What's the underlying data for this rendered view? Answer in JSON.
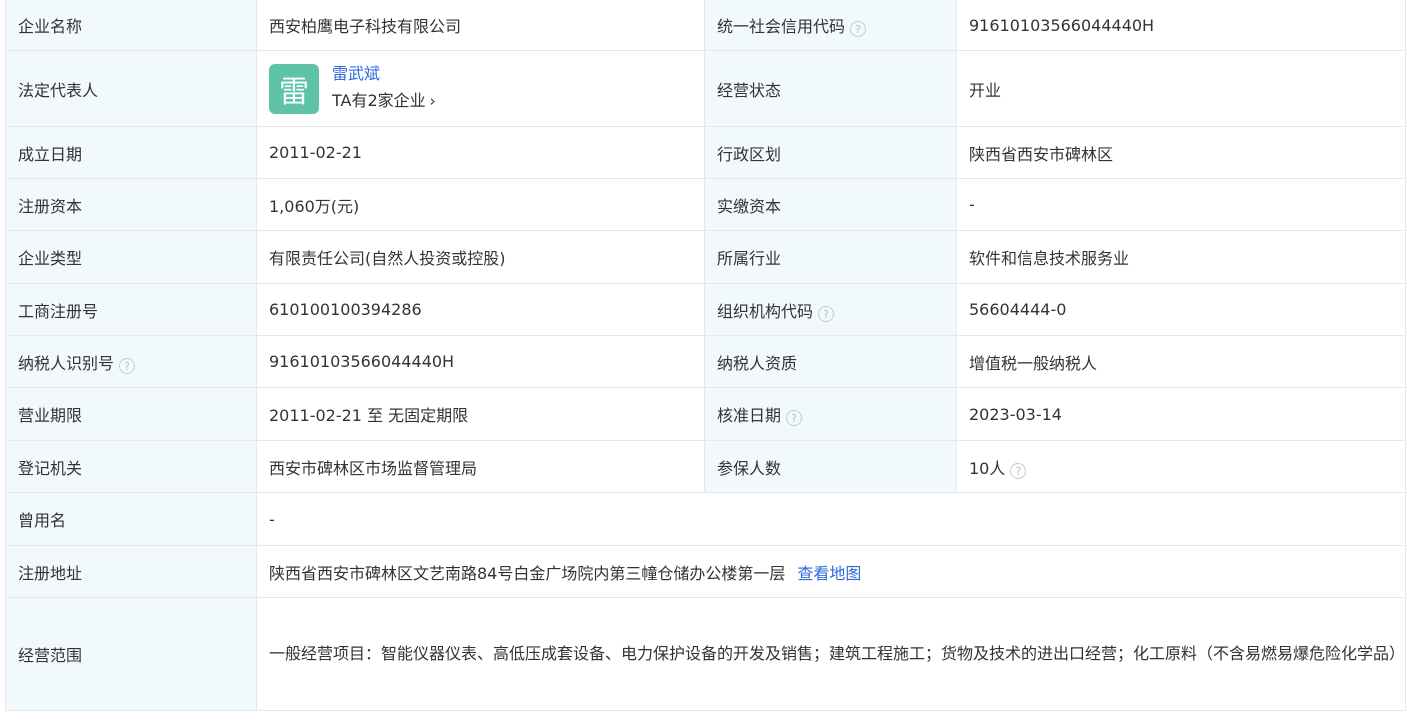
{
  "colors": {
    "label_bg": "#f2f9fc",
    "border": "#e4e8ee",
    "link": "#2e6bd7",
    "avatar_bg": "#5fc3a9",
    "text": "#333333"
  },
  "help_icon_glyph": "?",
  "rows": {
    "r1": {
      "l1": "企业名称",
      "v1": "西安柏鹰电子科技有限公司",
      "l2": "统一社会信用代码",
      "v2": "91610103566044440H"
    },
    "r2": {
      "l1": "法定代表人",
      "rep": {
        "avatar_char": "雷",
        "name": "雷武斌",
        "companies": "TA有2家企业",
        "chevron": "›"
      },
      "l2": "经营状态",
      "v2": "开业"
    },
    "r3": {
      "l1": "成立日期",
      "v1": "2011-02-21",
      "l2": "行政区划",
      "v2": "陕西省西安市碑林区"
    },
    "r4": {
      "l1": "注册资本",
      "v1": "1,060万(元)",
      "l2": "实缴资本",
      "v2": "-"
    },
    "r5": {
      "l1": "企业类型",
      "v1": "有限责任公司(自然人投资或控股)",
      "l2": "所属行业",
      "v2": "软件和信息技术服务业"
    },
    "r6": {
      "l1": "工商注册号",
      "v1": "610100100394286",
      "l2": "组织机构代码",
      "v2": "56604444-0"
    },
    "r7": {
      "l1": "纳税人识别号",
      "v1": "91610103566044440H",
      "l2": "纳税人资质",
      "v2": "增值税一般纳税人"
    },
    "r8": {
      "l1": "营业期限",
      "v1": "2011-02-21 至 无固定期限",
      "l2": "核准日期",
      "v2": "2023-03-14"
    },
    "r9": {
      "l1": "登记机关",
      "v1": "西安市碑林区市场监督管理局",
      "l2": "参保人数",
      "v2": "10人"
    },
    "r10": {
      "l1": "曾用名",
      "v1": "-"
    },
    "r11": {
      "l1": "注册地址",
      "v1": "陕西省西安市碑林区文艺南路84号白金广场院内第三幢仓储办公楼第一层",
      "map_link": "查看地图"
    },
    "r12": {
      "l1": "经营范围",
      "v1": "一般经营项目：智能仪器仪表、高低压成套设备、电力保护设备的开发及销售；建筑工程施工；货物及技术的进出口经营；化工原料（不含易燃易爆危险化学品）销售；计算机软硬件及耗材、办公设备、通信设备、电子产品、家用电器、自动化控制设备、仪器仪表的销售；计算机网络工程的施工；计算机及办公设备的维修。 （依法须经批准的项目，经相关部门批准后方可开展经营活动）"
    }
  }
}
